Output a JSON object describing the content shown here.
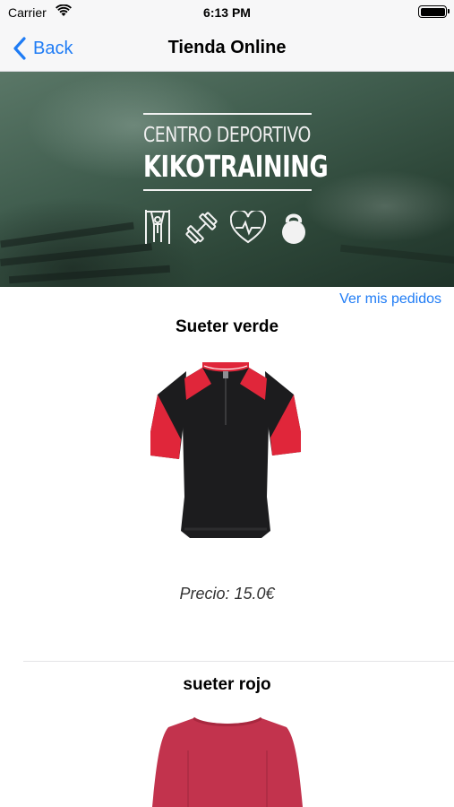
{
  "status_bar": {
    "carrier": "Carrier",
    "time": "6:13 PM"
  },
  "nav": {
    "back_label": "Back",
    "title": "Tienda Online"
  },
  "banner": {
    "subtitle": "CENTRO DEPORTIVO",
    "brand": "KIKOTRAINING",
    "icons": [
      "pullup-icon",
      "dumbbell-icon",
      "heartbeat-icon",
      "kettlebell-icon"
    ]
  },
  "orders_link": "Ver mis pedidos",
  "products": [
    {
      "name": "Sueter verde",
      "price": "Precio: 15.0€"
    },
    {
      "name": "sueter rojo"
    }
  ],
  "colors": {
    "accent": "#1f7cf5",
    "banner": "#3f5c4d",
    "shirt_red": "#e0263a",
    "shirt_black": "#1c1c1e",
    "shirt_rose": "#c2334d"
  }
}
